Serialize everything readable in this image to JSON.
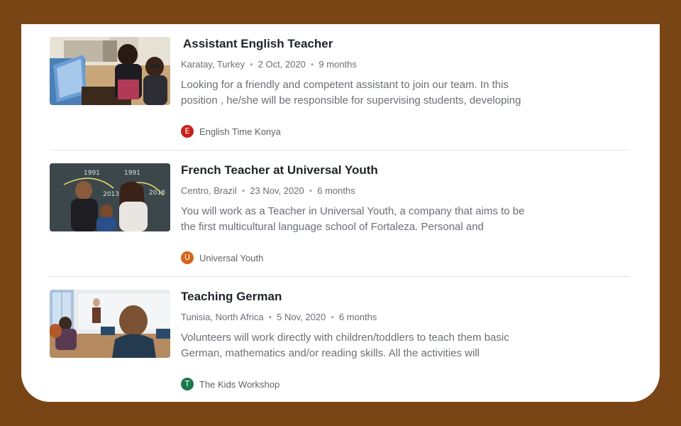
{
  "listings": [
    {
      "title": "Assistant English Teacher",
      "location": "Karatay, Turkey",
      "date": "2 Oct, 2020",
      "duration": "9 months",
      "description": "Looking for a friendly and competent assistant to join our team. In this position , he/she will be responsible for supervising students, developing l…",
      "org_name": "English Time Konya",
      "org_initial": "E",
      "org_color": "#c8231c"
    },
    {
      "title": "French Teacher at Universal Youth",
      "location": "Centro, Brazil",
      "date": "23 Nov, 2020",
      "duration": "6 months",
      "description": "You will work as a Teacher in Universal Youth, a company that aims to be the first multicultural language school of Fortaleza. Personal and professi…",
      "org_name": "Universal Youth",
      "org_initial": "U",
      "org_color": "#d5651a"
    },
    {
      "title": "Teaching German",
      "location": "Tunisia, North Africa",
      "date": "5 Nov, 2020",
      "duration": "6 months",
      "description": "Volunteers will work directly with children/toddlers to teach them basic German, mathematics and/or reading skills. All the activities will conduct…",
      "org_name": "The Kids Workshop",
      "org_initial": "T",
      "org_color": "#1a7a4a"
    }
  ],
  "thumbnails": [
    {
      "icon": "classroom-computers-photo"
    },
    {
      "icon": "chalkboard-teachers-photo",
      "chalk_text": [
        "1991",
        "1991",
        "2013",
        "2018"
      ]
    },
    {
      "icon": "classroom-students-photo"
    }
  ],
  "colors": {
    "background": "#7a4514",
    "card": "#ffffff"
  }
}
